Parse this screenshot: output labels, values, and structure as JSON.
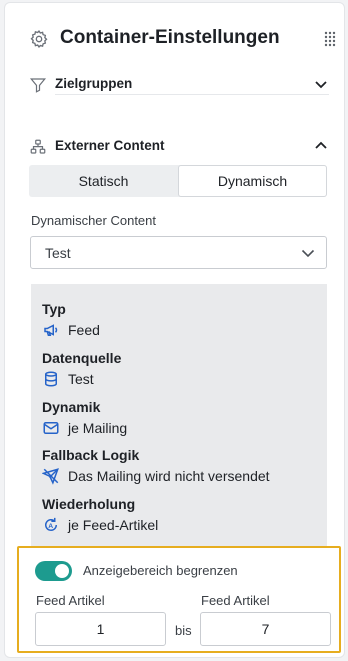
{
  "header": {
    "title": "Container-Einstellungen",
    "icon": "gear-icon",
    "drag_icon": "grip-icon"
  },
  "sections": {
    "zielgruppen": {
      "label": "Zielgruppen",
      "icon": "filter-icon",
      "state": "collapsed"
    },
    "externer_content": {
      "label": "Externer Content",
      "icon": "hierarchy-icon",
      "state": "expanded"
    }
  },
  "segmented": {
    "options": [
      "Statisch",
      "Dynamisch"
    ],
    "selected": "Dynamisch"
  },
  "dynamic_content": {
    "label": "Dynamischer Content",
    "value": "Test"
  },
  "info": {
    "typ": {
      "title": "Typ",
      "value": "Feed",
      "icon": "megaphone-icon"
    },
    "datenquelle": {
      "title": "Datenquelle",
      "value": "Test",
      "icon": "database-icon"
    },
    "dynamik": {
      "title": "Dynamik",
      "value": "je Mailing",
      "icon": "envelope-icon"
    },
    "fallback": {
      "title": "Fallback Logik",
      "value": "Das Mailing wird nicht versendet",
      "icon": "send-off-icon"
    },
    "wiederholung": {
      "title": "Wiederholung",
      "value": "je Feed-Artikel",
      "icon": "repeat-icon"
    }
  },
  "limit": {
    "toggle_label": "Anzeigebereich begrenzen",
    "toggle_on": true,
    "from_label": "Feed Artikel",
    "from_value": "1",
    "separator": "bis",
    "to_label": "Feed Artikel",
    "to_value": "7"
  },
  "colors": {
    "accent": "#1d9b8f",
    "icon_blue": "#2563c9",
    "highlight_border": "#e6ad1f",
    "info_bg": "#e9eaec"
  }
}
